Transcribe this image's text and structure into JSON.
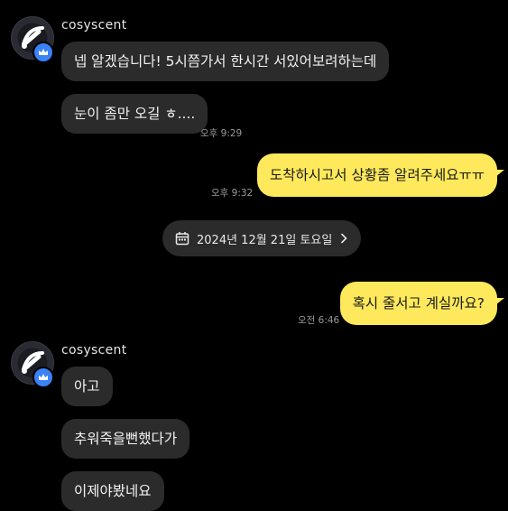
{
  "chat": {
    "sender_name": "cosyscent",
    "messages": [
      {
        "text": "넵 알겠습니다! 5시쯤가서 한시간 서있어보려하는데"
      },
      {
        "text": "눈이 좀만 오길 ㅎ....",
        "time": "오후 9:29"
      },
      {
        "text": "도착하시고서 상황좀 알려주세요ㅠㅠ",
        "time": "오후 9:32"
      },
      {
        "text": "혹시 줄서고 계실까요?",
        "time": "오전 6:46"
      },
      {
        "text": "아고"
      },
      {
        "text": "추워죽을뻔했다가"
      },
      {
        "text": "이제야봤네요"
      }
    ],
    "date_divider": "2024년 12월 21일 토요일"
  },
  "icons": {
    "calendar": "calendar-icon",
    "chevron": "chevron-right-icon",
    "crown": "crown-icon"
  },
  "colors": {
    "background": "#000000",
    "incoming_bubble": "#2b2b2b",
    "outgoing_bubble": "#fde95b",
    "badge": "#3b82f6"
  }
}
